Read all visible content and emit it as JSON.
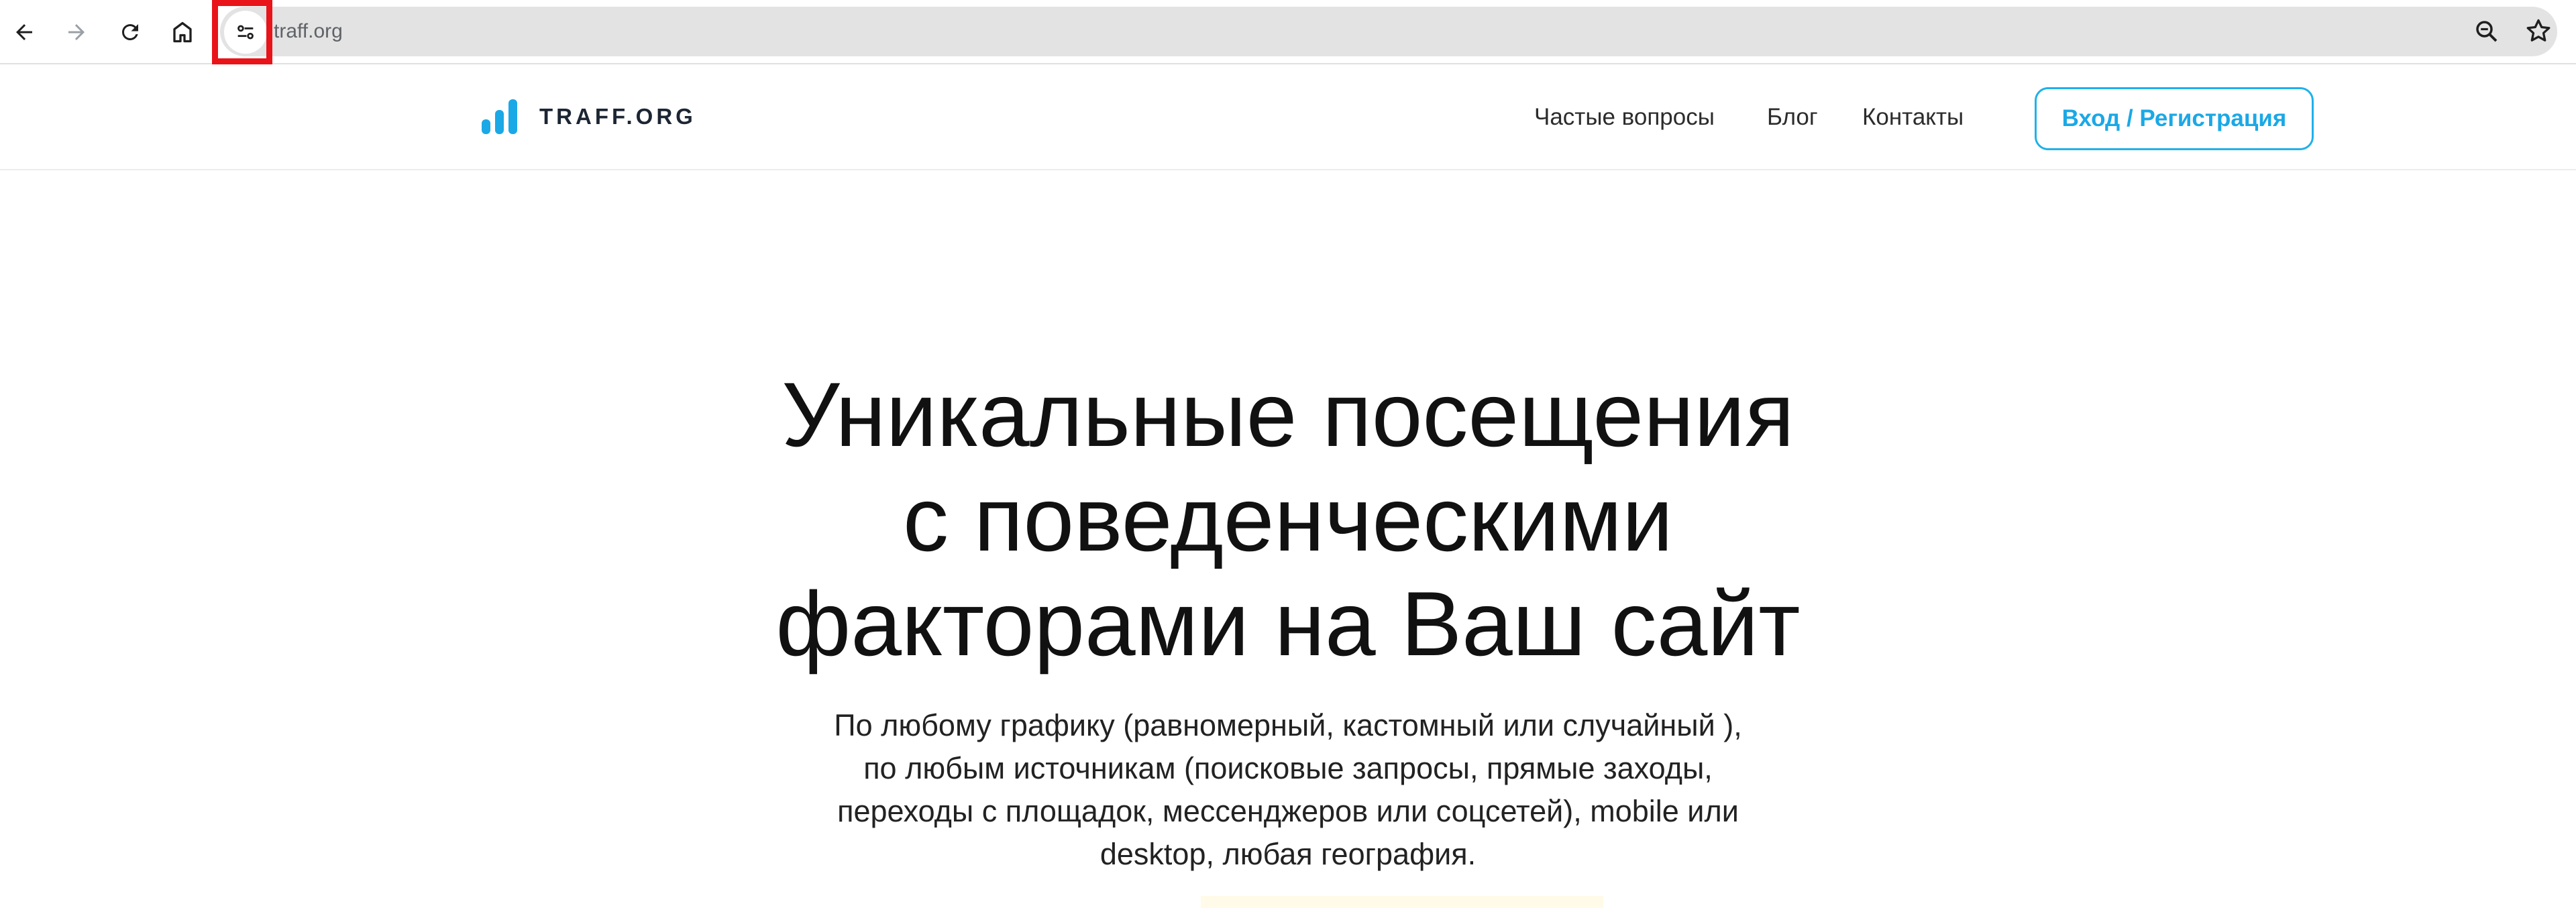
{
  "browser": {
    "url": "traff.org",
    "icons": {
      "back": "back-arrow-icon",
      "forward": "forward-arrow-icon",
      "reload": "reload-icon",
      "home": "home-icon",
      "site_info": "tune-icon",
      "zoom": "zoom-icon",
      "bookmark": "star-icon"
    }
  },
  "header": {
    "logo_text": "TRAFF.ORG",
    "nav": [
      {
        "label": "Частые вопросы"
      },
      {
        "label": "Блог"
      },
      {
        "label": "Контакты"
      }
    ],
    "login_label": "Вход / Регистрация"
  },
  "hero": {
    "title_lines": [
      "Уникальные посещения",
      "с поведенческими",
      "факторами на Ваш сайт"
    ],
    "subtitle_lines": [
      "По любому графику (равномерный, кастомный или случайный ),",
      "по любым источникам (поисковые запросы, прямые заходы,",
      "переходы с площадок, мессенджеров или соцсетей), mobile или",
      "desktop, любая география."
    ]
  },
  "colors": {
    "accent": "#1ba8e6",
    "highlight": "#e8141a",
    "text": "#111111"
  }
}
